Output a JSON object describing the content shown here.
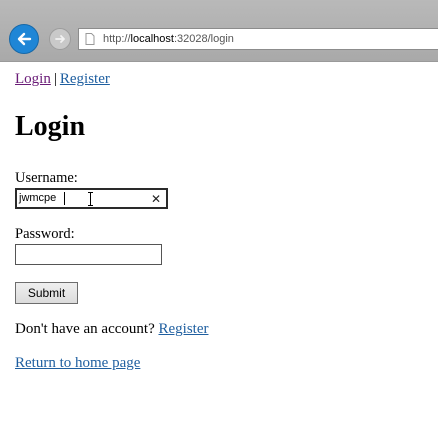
{
  "browser": {
    "url_prefix": "http://",
    "url_host": "localhost",
    "url_rest": ":32028/login"
  },
  "nav": {
    "login_link": "Login",
    "separator": "|",
    "register_link": "Register"
  },
  "page": {
    "title": "Login",
    "username_label": "Username:",
    "username_value": "jwmcpe",
    "password_label": "Password:",
    "password_value": "",
    "submit_label": "Submit",
    "no_account_text": "Don't have an account?",
    "register_link": "Register",
    "home_link": "Return to home page"
  },
  "icons": {
    "back": "back-arrow-icon",
    "forward": "forward-arrow-icon",
    "page": "page-icon",
    "clear": "clear-x-icon"
  },
  "colors": {
    "back_button": "#1f86d6",
    "visited_link": "#6a1b77",
    "link": "#1f5fa0"
  }
}
